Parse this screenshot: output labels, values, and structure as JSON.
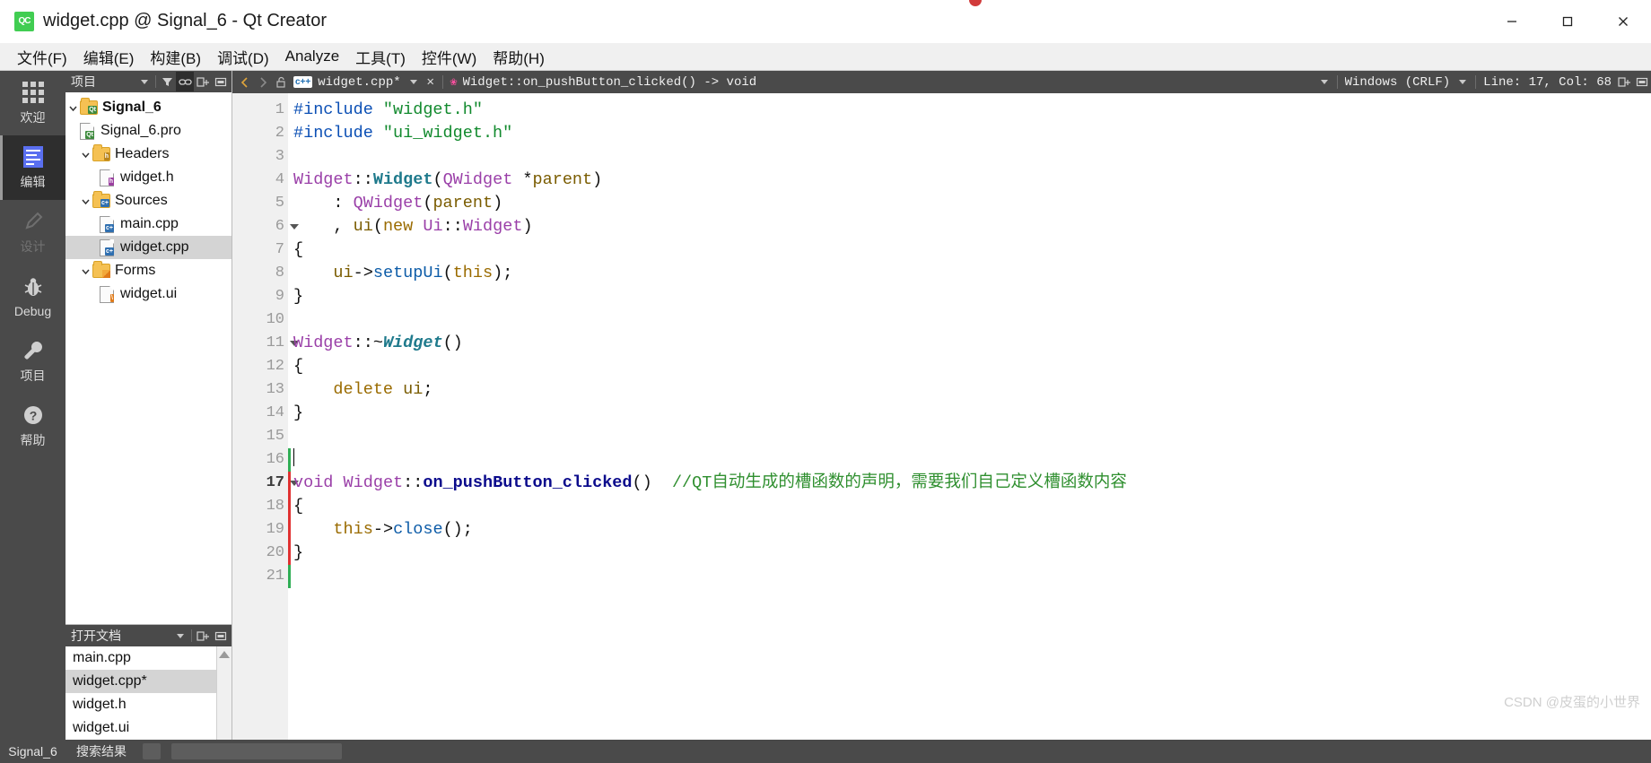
{
  "window": {
    "title": "widget.cpp @ Signal_6 - Qt Creator",
    "app_logo_text": "QC",
    "minimize_label": "Minimize",
    "maximize_label": "Maximize",
    "close_label": "Close"
  },
  "menubar": {
    "items": [
      {
        "label": "文件(F)",
        "name": "menu-file"
      },
      {
        "label": "编辑(E)",
        "name": "menu-edit"
      },
      {
        "label": "构建(B)",
        "name": "menu-build"
      },
      {
        "label": "调试(D)",
        "name": "menu-debug"
      },
      {
        "label": "Analyze",
        "name": "menu-analyze"
      },
      {
        "label": "工具(T)",
        "name": "menu-tools"
      },
      {
        "label": "控件(W)",
        "name": "menu-widgets"
      },
      {
        "label": "帮助(H)",
        "name": "menu-help"
      }
    ]
  },
  "modebar": {
    "items": [
      {
        "label": "欢迎",
        "icon": "grid-icon",
        "active": false,
        "disabled": false
      },
      {
        "label": "编辑",
        "icon": "edit-icon",
        "active": true,
        "disabled": false
      },
      {
        "label": "设计",
        "icon": "pencil-icon",
        "active": false,
        "disabled": true
      },
      {
        "label": "Debug",
        "icon": "bug-icon",
        "active": false,
        "disabled": false
      },
      {
        "label": "项目",
        "icon": "wrench-icon",
        "active": false,
        "disabled": false
      },
      {
        "label": "帮助",
        "icon": "question-icon",
        "active": false,
        "disabled": false
      }
    ],
    "bottom_label": "Signal_6"
  },
  "project_panel": {
    "header_title": "项目",
    "filter_icon": "filter-icon",
    "link_icon": "link-with-editor-icon",
    "split_icon": "add-split-icon",
    "close_icon": "close-split-icon",
    "tree": [
      {
        "label": "Signal_6",
        "icon": "folder-qt",
        "level": 0,
        "expanded": true,
        "bold": true,
        "selected": false
      },
      {
        "label": "Signal_6.pro",
        "icon": "file-pro",
        "level": 1,
        "expanded": null,
        "bold": false,
        "selected": false
      },
      {
        "label": "Headers",
        "icon": "folder-h",
        "level": 1,
        "expanded": true,
        "bold": false,
        "selected": false
      },
      {
        "label": "widget.h",
        "icon": "file-h",
        "level": 2,
        "expanded": null,
        "bold": false,
        "selected": false
      },
      {
        "label": "Sources",
        "icon": "folder-cpp",
        "level": 1,
        "expanded": true,
        "bold": false,
        "selected": false
      },
      {
        "label": "main.cpp",
        "icon": "file-cpp",
        "level": 2,
        "expanded": null,
        "bold": false,
        "selected": false
      },
      {
        "label": "widget.cpp",
        "icon": "file-cpp",
        "level": 2,
        "expanded": null,
        "bold": false,
        "selected": true
      },
      {
        "label": "Forms",
        "icon": "folder-ui",
        "level": 1,
        "expanded": true,
        "bold": false,
        "selected": false
      },
      {
        "label": "widget.ui",
        "icon": "file-ui",
        "level": 2,
        "expanded": null,
        "bold": false,
        "selected": false
      }
    ]
  },
  "open_documents": {
    "header_title": "打开文档",
    "split_icon": "add-split-icon",
    "close_icon": "close-split-icon",
    "items": [
      {
        "label": "main.cpp",
        "selected": false
      },
      {
        "label": "widget.cpp*",
        "selected": true
      },
      {
        "label": "widget.h",
        "selected": false
      },
      {
        "label": "widget.ui",
        "selected": false
      }
    ]
  },
  "editor_toolbar": {
    "back_icon": "navigate-back-icon",
    "forward_icon": "navigate-forward-icon",
    "lock_icon": "unlocked-icon",
    "file_badge": "c++",
    "file_name": "widget.cpp*",
    "file_close_icon": "close-icon",
    "symbol_badge": "function-icon",
    "symbol_name": "Widget::on_pushButton_clicked() -> void",
    "line_ending": "Windows (CRLF)",
    "cursor_position": "Line: 17, Col: 68",
    "split_icon": "split-editor-icon",
    "close_split_icon": "close-split-icon"
  },
  "editor": {
    "line_count": 21,
    "lines": [
      {
        "no": 1,
        "fold": false,
        "change": "",
        "tokens": [
          {
            "t": "#include ",
            "c": "c-pre"
          },
          {
            "t": "\"widget.h\"",
            "c": "c-str"
          }
        ]
      },
      {
        "no": 2,
        "fold": false,
        "change": "",
        "tokens": [
          {
            "t": "#include ",
            "c": "c-pre"
          },
          {
            "t": "\"ui_widget.h\"",
            "c": "c-str"
          }
        ]
      },
      {
        "no": 3,
        "fold": false,
        "change": "",
        "tokens": []
      },
      {
        "no": 4,
        "fold": false,
        "change": "",
        "tokens": [
          {
            "t": "Widget",
            "c": "c-type"
          },
          {
            "t": "::",
            "c": "c-plain"
          },
          {
            "t": "Widget",
            "c": "c-cls"
          },
          {
            "t": "(",
            "c": "c-plain"
          },
          {
            "t": "QWidget",
            "c": "c-type"
          },
          {
            "t": " *",
            "c": "c-plain"
          },
          {
            "t": "parent",
            "c": "c-var"
          },
          {
            "t": ")",
            "c": "c-plain"
          }
        ]
      },
      {
        "no": 5,
        "fold": false,
        "change": "",
        "tokens": [
          {
            "t": "    : ",
            "c": "c-plain"
          },
          {
            "t": "QWidget",
            "c": "c-type"
          },
          {
            "t": "(",
            "c": "c-plain"
          },
          {
            "t": "parent",
            "c": "c-var"
          },
          {
            "t": ")",
            "c": "c-plain"
          }
        ]
      },
      {
        "no": 6,
        "fold": true,
        "change": "",
        "tokens": [
          {
            "t": "    , ",
            "c": "c-plain"
          },
          {
            "t": "ui",
            "c": "c-var"
          },
          {
            "t": "(",
            "c": "c-plain"
          },
          {
            "t": "new",
            "c": "c-kw"
          },
          {
            "t": " ",
            "c": "c-plain"
          },
          {
            "t": "Ui",
            "c": "c-type"
          },
          {
            "t": "::",
            "c": "c-plain"
          },
          {
            "t": "Widget",
            "c": "c-type"
          },
          {
            "t": ")",
            "c": "c-plain"
          }
        ]
      },
      {
        "no": 7,
        "fold": false,
        "change": "",
        "tokens": [
          {
            "t": "{",
            "c": "c-plain"
          }
        ]
      },
      {
        "no": 8,
        "fold": false,
        "change": "",
        "tokens": [
          {
            "t": "    ",
            "c": "c-plain"
          },
          {
            "t": "ui",
            "c": "c-var"
          },
          {
            "t": "->",
            "c": "c-plain"
          },
          {
            "t": "setupUi",
            "c": "c-member"
          },
          {
            "t": "(",
            "c": "c-plain"
          },
          {
            "t": "this",
            "c": "c-kw"
          },
          {
            "t": ");",
            "c": "c-plain"
          }
        ]
      },
      {
        "no": 9,
        "fold": false,
        "change": "",
        "tokens": [
          {
            "t": "}",
            "c": "c-plain"
          }
        ]
      },
      {
        "no": 10,
        "fold": false,
        "change": "",
        "tokens": []
      },
      {
        "no": 11,
        "fold": true,
        "change": "",
        "tokens": [
          {
            "t": "Widget",
            "c": "c-type"
          },
          {
            "t": "::~",
            "c": "c-plain"
          },
          {
            "t": "Widget",
            "c": "c-clsi"
          },
          {
            "t": "()",
            "c": "c-plain"
          }
        ]
      },
      {
        "no": 12,
        "fold": false,
        "change": "",
        "tokens": [
          {
            "t": "{",
            "c": "c-plain"
          }
        ]
      },
      {
        "no": 13,
        "fold": false,
        "change": "",
        "tokens": [
          {
            "t": "    ",
            "c": "c-plain"
          },
          {
            "t": "delete",
            "c": "c-kw"
          },
          {
            "t": " ",
            "c": "c-plain"
          },
          {
            "t": "ui",
            "c": "c-var"
          },
          {
            "t": ";",
            "c": "c-plain"
          }
        ]
      },
      {
        "no": 14,
        "fold": false,
        "change": "",
        "tokens": [
          {
            "t": "}",
            "c": "c-plain"
          }
        ]
      },
      {
        "no": 15,
        "fold": false,
        "change": "",
        "tokens": []
      },
      {
        "no": 16,
        "fold": false,
        "change": "green",
        "tokens": []
      },
      {
        "no": 17,
        "fold": true,
        "change": "red",
        "tokens": [
          {
            "t": "void",
            "c": "c-type"
          },
          {
            "t": " ",
            "c": "c-plain"
          },
          {
            "t": "Widget",
            "c": "c-type"
          },
          {
            "t": "::",
            "c": "c-plain"
          },
          {
            "t": "on_pushButton_clicked",
            "c": "c-fn"
          },
          {
            "t": "()",
            "c": "c-plain"
          },
          {
            "t": "  ",
            "c": "c-plain"
          },
          {
            "t": "//QT自动生成的槽函数的声明，需要我们自己定义槽函数内容",
            "c": "c-cmt"
          }
        ]
      },
      {
        "no": 18,
        "fold": false,
        "change": "red",
        "tokens": [
          {
            "t": "{",
            "c": "c-plain"
          }
        ]
      },
      {
        "no": 19,
        "fold": false,
        "change": "red",
        "tokens": [
          {
            "t": "    ",
            "c": "c-plain"
          },
          {
            "t": "this",
            "c": "c-kw"
          },
          {
            "t": "->",
            "c": "c-plain"
          },
          {
            "t": "close",
            "c": "c-member"
          },
          {
            "t": "();",
            "c": "c-plain"
          }
        ]
      },
      {
        "no": 20,
        "fold": false,
        "change": "red",
        "tokens": [
          {
            "t": "}",
            "c": "c-plain"
          }
        ]
      },
      {
        "no": 21,
        "fold": false,
        "change": "green",
        "tokens": []
      }
    ],
    "current_line": 17
  },
  "bottombar": {
    "project_label": "Signal_6",
    "search_label": "搜索结果"
  },
  "watermark": {
    "text": "CSDN @皮蛋的小世界"
  },
  "colors": {
    "panel_dark": "#4a4a4a",
    "mode_active": "#2e2e2e",
    "selection": "#d4d4d4",
    "gutter": "#f0f0f0",
    "qt_green": "#41cd52",
    "change_green": "#2fae55",
    "change_red": "#e03131"
  }
}
